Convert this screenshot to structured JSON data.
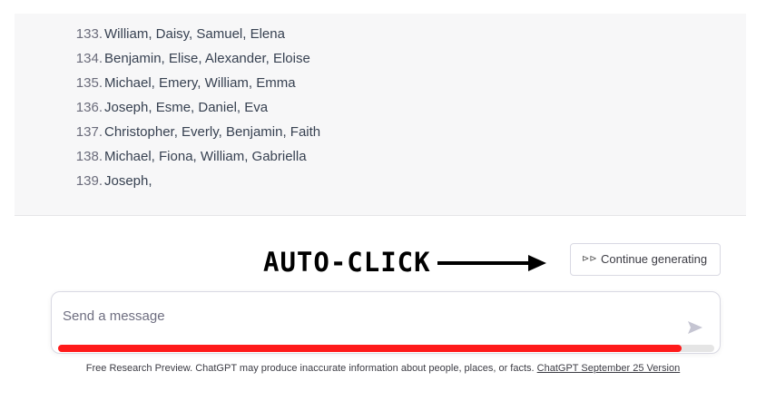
{
  "conversation": {
    "list_items": [
      {
        "number": "133.",
        "text": "William, Daisy, Samuel, Elena"
      },
      {
        "number": "134.",
        "text": "Benjamin, Elise, Alexander, Eloise"
      },
      {
        "number": "135.",
        "text": "Michael, Emery, William, Emma"
      },
      {
        "number": "136.",
        "text": "Joseph, Esme, Daniel, Eva"
      },
      {
        "number": "137.",
        "text": "Christopher, Everly, Benjamin, Faith"
      },
      {
        "number": "138.",
        "text": "Michael, Fiona, William, Gabriella"
      },
      {
        "number": "139.",
        "text": "Joseph,"
      }
    ]
  },
  "overlay": {
    "label": "AUTO-CLICK",
    "arrow_icon": "right-arrow-icon"
  },
  "continue_button": {
    "icon": "double-play-icon",
    "icon_glyph": "⊳⊳",
    "label": "Continue generating"
  },
  "composer": {
    "placeholder": "Send a message",
    "send_icon": "send-icon",
    "progress_percent": 95,
    "progress_color": "#ff1a1a"
  },
  "footer": {
    "text": "Free Research Preview. ChatGPT may produce inaccurate information about people, places, or facts.",
    "link_label": "ChatGPT September 25 Version"
  }
}
